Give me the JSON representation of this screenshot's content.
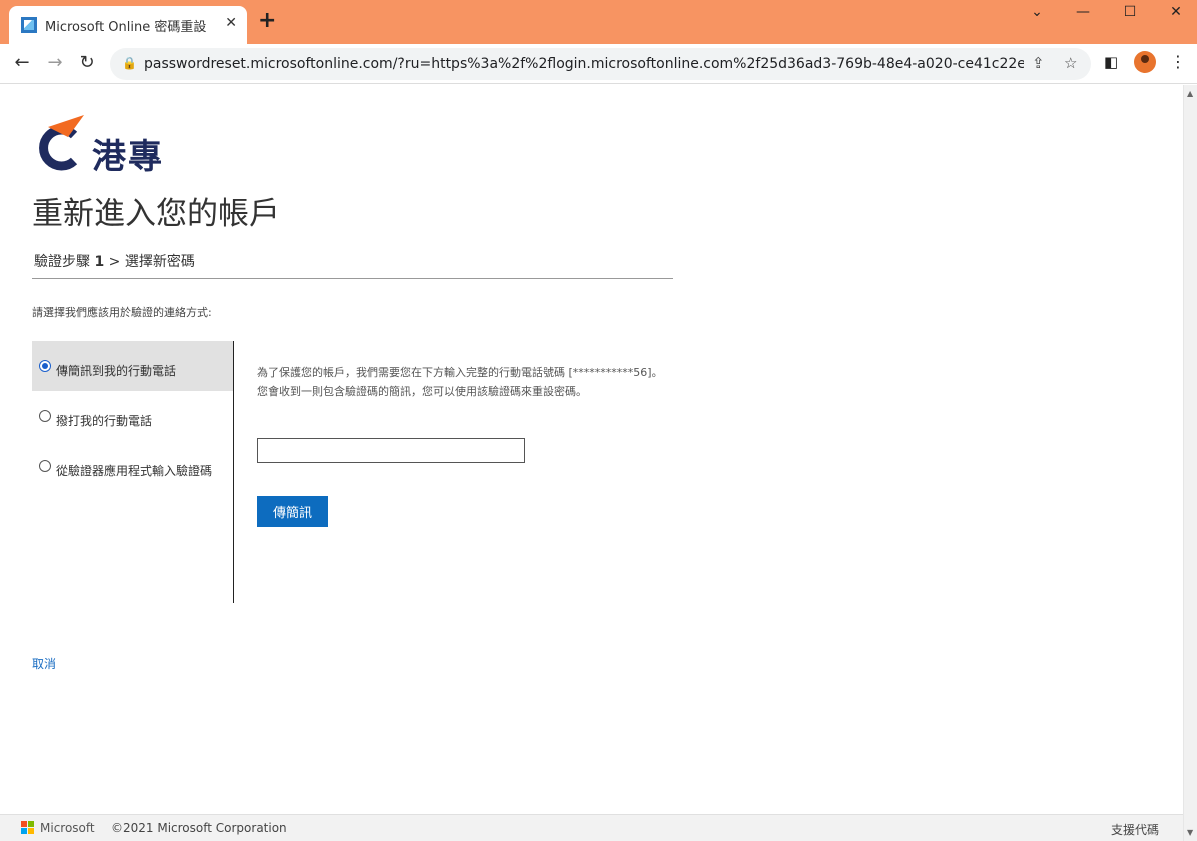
{
  "browser": {
    "tab_title": "Microsoft Online 密碼重設",
    "tab_close_glyph": "✕",
    "new_tab_glyph": "+",
    "url": "passwordreset.microsoftonline.com/?ru=https%3a%2f%2flogin.microsoftonline.com%2f25d36ad3-769b-48e4-a020-ce41c22e0cb2...",
    "window_controls": {
      "collapse": "⌄",
      "minimize": "—",
      "maximize": "☐",
      "close": "✕"
    },
    "nav": {
      "back": "←",
      "forward": "→",
      "reload": "↻"
    },
    "icons": {
      "lock": "🔒",
      "share": "⇪",
      "star": "☆",
      "sidepanel": "◧",
      "menu": "⋮"
    }
  },
  "header": {
    "logo_text": "港專",
    "colors": {
      "logo_dark": "#1f2b5e",
      "logo_orange": "#f26a21"
    }
  },
  "main": {
    "title": "重新進入您的帳戶",
    "breadcrumb": {
      "step_prefix": "驗證步驟",
      "step_number": "1",
      "separator": " > ",
      "next": "選擇新密碼"
    },
    "instruction": "請選擇我們應該用於驗證的連絡方式:",
    "options": [
      {
        "label": "傳簡訊到我的行動電話",
        "selected": true
      },
      {
        "label": "撥打我的行動電話",
        "selected": false
      },
      {
        "label": "從驗證器應用程式輸入驗證碼",
        "selected": false
      }
    ],
    "description_line1": "為了保護您的帳戶，我們需要您在下方輸入完整的行動電話號碼 [***********56]。",
    "description_line2": "您會收到一則包含驗證碼的簡訊，您可以使用該驗證碼來重設密碼。",
    "phone_input_value": "",
    "send_button": "傳簡訊",
    "cancel_link": "取消",
    "accent_color": "#0d6cbf"
  },
  "footer": {
    "brand": "Microsoft",
    "copyright": "©2021 Microsoft Corporation",
    "support_code": "支援代碼"
  }
}
